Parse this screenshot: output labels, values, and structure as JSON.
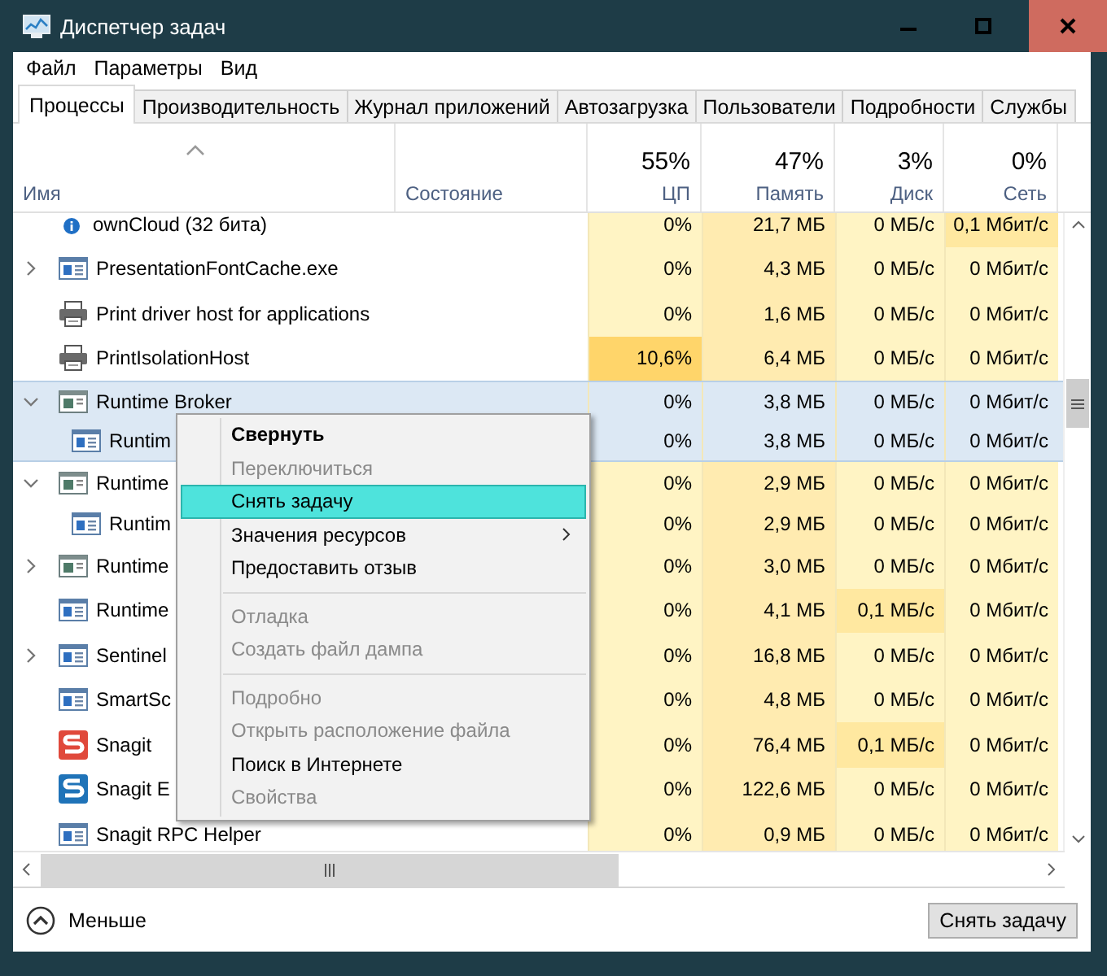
{
  "window": {
    "title": "Диспетчер задач"
  },
  "menu_bar": [
    "Файл",
    "Параметры",
    "Вид"
  ],
  "tabs": [
    {
      "label": "Процессы",
      "selected": true
    },
    {
      "label": "Производительность",
      "selected": false
    },
    {
      "label": "Журнал приложений",
      "selected": false
    },
    {
      "label": "Автозагрузка",
      "selected": false
    },
    {
      "label": "Пользователи",
      "selected": false
    },
    {
      "label": "Подробности",
      "selected": false
    },
    {
      "label": "Службы",
      "selected": false
    }
  ],
  "columns": [
    {
      "label": "Имя"
    },
    {
      "label": "Состояние"
    },
    {
      "total": "55%",
      "label": "ЦП"
    },
    {
      "total": "47%",
      "label": "Память"
    },
    {
      "total": "3%",
      "label": "Диск"
    },
    {
      "total": "0%",
      "label": "Сеть"
    }
  ],
  "rows": [
    {
      "name": "ownCloud (32 бита)",
      "kind": "info",
      "selected": false,
      "cells": [
        {
          "text": "0%",
          "hot": false
        },
        {
          "text": "21,7 МБ",
          "hot": false
        },
        {
          "text": "0 МБ/с",
          "hot": false
        },
        {
          "text": "0,1 Мбит/с",
          "hot": true
        }
      ]
    },
    {
      "name": "PresentationFontCache.exe",
      "kind": "window",
      "expanded": false,
      "selected": false,
      "cells": [
        {
          "text": "0%",
          "hot": false
        },
        {
          "text": "4,3 МБ",
          "hot": false
        },
        {
          "text": "0 МБ/с",
          "hot": false
        },
        {
          "text": "0 Мбит/с",
          "hot": false
        }
      ]
    },
    {
      "name": "Print driver host for applications",
      "kind": "printer",
      "selected": false,
      "cells": [
        {
          "text": "0%",
          "hot": false
        },
        {
          "text": "1,6 МБ",
          "hot": false
        },
        {
          "text": "0 МБ/с",
          "hot": false
        },
        {
          "text": "0 Мбит/с",
          "hot": false
        }
      ]
    },
    {
      "name": "PrintIsolationHost",
      "kind": "printer",
      "selected": false,
      "cells": [
        {
          "text": "10,6%",
          "hot": true
        },
        {
          "text": "6,4 МБ",
          "hot": false
        },
        {
          "text": "0 МБ/с",
          "hot": false
        },
        {
          "text": "0 Мбит/с",
          "hot": false
        }
      ]
    },
    {
      "name": "Runtime Broker",
      "kind": "app",
      "expanded": true,
      "selected": true,
      "cells": [
        {
          "text": "0%",
          "hot": false
        },
        {
          "text": "3,8 МБ",
          "hot": false
        },
        {
          "text": "0 МБ/с",
          "hot": false
        },
        {
          "text": "0 Мбит/с",
          "hot": false
        }
      ],
      "children": [
        {
          "name": "Runtim",
          "kind": "window",
          "selected": true,
          "cells": [
            {
              "text": "0%",
              "hot": false
            },
            {
              "text": "3,8 МБ",
              "hot": false
            },
            {
              "text": "0 МБ/с",
              "hot": false
            },
            {
              "text": "0 Мбит/с",
              "hot": false
            }
          ]
        }
      ]
    },
    {
      "name": "Runtime",
      "kind": "app",
      "expanded": true,
      "selected": false,
      "cells": [
        {
          "text": "0%",
          "hot": false
        },
        {
          "text": "2,9 МБ",
          "hot": false
        },
        {
          "text": "0 МБ/с",
          "hot": false
        },
        {
          "text": "0 Мбит/с",
          "hot": false
        }
      ],
      "children": [
        {
          "name": "Runtim",
          "kind": "window",
          "selected": false,
          "cells": [
            {
              "text": "0%",
              "hot": false
            },
            {
              "text": "2,9 МБ",
              "hot": false
            },
            {
              "text": "0 МБ/с",
              "hot": false
            },
            {
              "text": "0 Мбит/с",
              "hot": false
            }
          ]
        }
      ]
    },
    {
      "name": "Runtime",
      "kind": "app",
      "expanded": false,
      "selected": false,
      "cells": [
        {
          "text": "0%",
          "hot": false
        },
        {
          "text": "3,0 МБ",
          "hot": false
        },
        {
          "text": "0 МБ/с",
          "hot": false
        },
        {
          "text": "0 Мбит/с",
          "hot": false
        }
      ]
    },
    {
      "name": "Runtime",
      "kind": "window",
      "selected": false,
      "cells": [
        {
          "text": "0%",
          "hot": false
        },
        {
          "text": "4,1 МБ",
          "hot": false
        },
        {
          "text": "0,1 МБ/с",
          "hot": true
        },
        {
          "text": "0 Мбит/с",
          "hot": false
        }
      ]
    },
    {
      "name": "Sentinel",
      "kind": "window",
      "expanded": false,
      "selected": false,
      "cells": [
        {
          "text": "0%",
          "hot": false
        },
        {
          "text": "16,8 МБ",
          "hot": false
        },
        {
          "text": "0 МБ/с",
          "hot": false
        },
        {
          "text": "0 Мбит/с",
          "hot": false
        }
      ]
    },
    {
      "name": "SmartSc",
      "kind": "window",
      "selected": false,
      "cells": [
        {
          "text": "0%",
          "hot": false
        },
        {
          "text": "4,8 МБ",
          "hot": false
        },
        {
          "text": "0 МБ/с",
          "hot": false
        },
        {
          "text": "0 Мбит/с",
          "hot": false
        }
      ]
    },
    {
      "name": "Snagit",
      "kind": "s-red",
      "selected": false,
      "cells": [
        {
          "text": "0%",
          "hot": false
        },
        {
          "text": "76,4 МБ",
          "hot": false
        },
        {
          "text": "0,1 МБ/с",
          "hot": true
        },
        {
          "text": "0 Мбит/с",
          "hot": false
        }
      ]
    },
    {
      "name": "Snagit E",
      "kind": "s-blue",
      "selected": false,
      "cells": [
        {
          "text": "0%",
          "hot": false
        },
        {
          "text": "122,6 МБ",
          "hot": false
        },
        {
          "text": "0 МБ/с",
          "hot": false
        },
        {
          "text": "0 Мбит/с",
          "hot": false
        }
      ]
    },
    {
      "name": "Snagit RPC Helper",
      "kind": "window",
      "selected": false,
      "cells": [
        {
          "text": "0%",
          "hot": false
        },
        {
          "text": "0,9 МБ",
          "hot": false
        },
        {
          "text": "0 МБ/с",
          "hot": false
        },
        {
          "text": "0 Мбит/с",
          "hot": false
        }
      ]
    }
  ],
  "context_menu": [
    {
      "kind": "item",
      "label": "Свернуть",
      "default": true,
      "disabled": false,
      "selected": false
    },
    {
      "kind": "item",
      "label": "Переключиться",
      "disabled": true,
      "selected": false
    },
    {
      "kind": "item",
      "label": "Снять задачу",
      "disabled": false,
      "selected": true
    },
    {
      "kind": "item",
      "label": "Значения ресурсов",
      "disabled": false,
      "selected": false,
      "submenu": true
    },
    {
      "kind": "item",
      "label": "Предоставить отзыв",
      "disabled": false,
      "selected": false
    },
    {
      "kind": "separator"
    },
    {
      "kind": "item",
      "label": "Отладка",
      "disabled": true,
      "selected": false
    },
    {
      "kind": "item",
      "label": "Создать файл дампа",
      "disabled": true,
      "selected": false
    },
    {
      "kind": "separator"
    },
    {
      "kind": "item",
      "label": "Подробно",
      "disabled": true,
      "selected": false
    },
    {
      "kind": "item",
      "label": "Открыть расположение файла",
      "disabled": true,
      "selected": false
    },
    {
      "kind": "item",
      "label": "Поиск в Интернете",
      "disabled": false,
      "selected": false
    },
    {
      "kind": "item",
      "label": "Свойства",
      "disabled": true,
      "selected": false
    }
  ],
  "footer": {
    "toggle": "Меньше",
    "end_task_button": "Снять задачу"
  }
}
